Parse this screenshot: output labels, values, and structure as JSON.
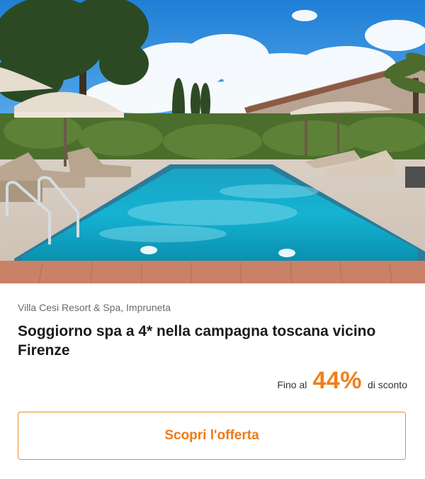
{
  "offer": {
    "location": "Villa Cesi Resort & Spa, Impruneta",
    "title": "Soggiorno spa a 4* nella campagna toscana vicino Firenze",
    "discount_prefix": "Fino al",
    "discount_value": "44%",
    "discount_suffix": "di sconto",
    "cta_label": "Scopri l'offerta"
  },
  "colors": {
    "accent": "#f07f1b",
    "text": "#1b1b1b",
    "muted": "#6b6b6b"
  },
  "hero_image": {
    "subject": "outdoor swimming pool with umbrellas and sun loungers",
    "icon": "photo"
  }
}
